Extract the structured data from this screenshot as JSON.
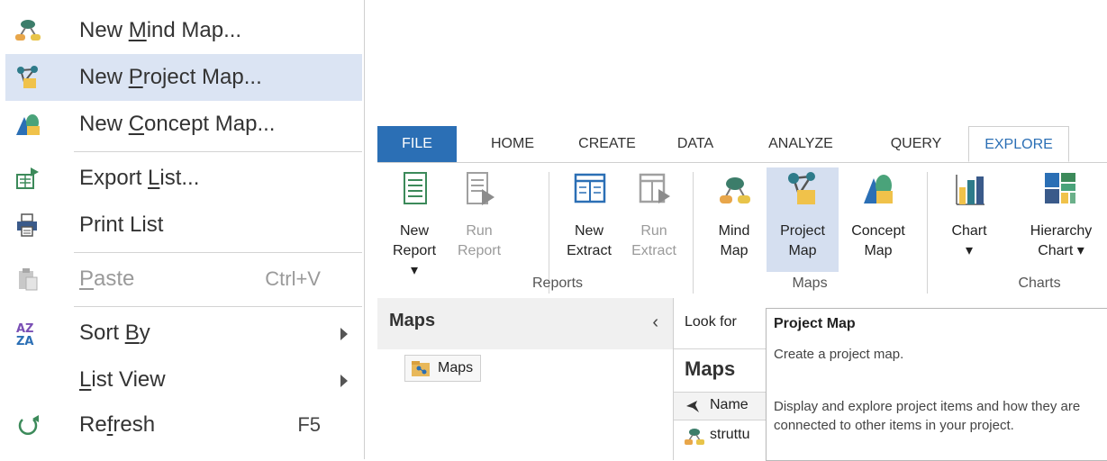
{
  "context_menu": {
    "items": [
      {
        "pre": "New ",
        "u": "M",
        "post": "ind Map...",
        "shortcut": "",
        "icon": "mind-map-icon"
      },
      {
        "pre": "New ",
        "u": "P",
        "post": "roject Map...",
        "shortcut": "",
        "icon": "project-map-icon",
        "highlighted": true
      },
      {
        "pre": "New ",
        "u": "C",
        "post": "oncept Map...",
        "shortcut": "",
        "icon": "concept-map-icon"
      },
      {
        "pre": "Export ",
        "u": "L",
        "post": "ist...",
        "shortcut": "",
        "icon": "export-list-icon"
      },
      {
        "pre": "Print List",
        "u": "",
        "post": "",
        "shortcut": "",
        "icon": "print-list-icon"
      },
      {
        "pre": "",
        "u": "P",
        "post": "aste",
        "shortcut": "Ctrl+V",
        "icon": "paste-icon",
        "disabled": true
      },
      {
        "pre": "Sort ",
        "u": "B",
        "post": "y",
        "shortcut": "",
        "icon": "sort-az-icon",
        "submenu": true
      },
      {
        "pre": "",
        "u": "L",
        "post": "ist View",
        "shortcut": "",
        "icon": "",
        "submenu": true
      },
      {
        "pre": "Re",
        "u": "f",
        "post": "resh",
        "shortcut": "F5",
        "icon": "refresh-icon"
      }
    ]
  },
  "ribbon": {
    "tabs": [
      "FILE",
      "HOME",
      "CREATE",
      "DATA",
      "ANALYZE",
      "QUERY",
      "EXPLORE"
    ],
    "active_tab": "EXPLORE",
    "buttons": {
      "new_report": {
        "line1": "New",
        "line2": "Report ▾"
      },
      "run_report": {
        "line1": "Run",
        "line2": "Report"
      },
      "new_extract": {
        "line1": "New",
        "line2": "Extract"
      },
      "run_extract": {
        "line1": "Run",
        "line2": "Extract"
      },
      "mind_map": {
        "line1": "Mind",
        "line2": "Map"
      },
      "project_map": {
        "line1": "Project",
        "line2": "Map"
      },
      "concept_map": {
        "line1": "Concept",
        "line2": "Map"
      },
      "chart": {
        "line1": "Chart",
        "line2": "▾"
      },
      "hierarchy_chart": {
        "line1": "Hierarchy",
        "line2": "Chart ▾"
      }
    },
    "groups": {
      "reports": "Reports",
      "maps": "Maps",
      "charts": "Charts"
    }
  },
  "nav_pane": {
    "title": "Maps",
    "collapse": "‹",
    "item": "Maps"
  },
  "list_pane": {
    "look_for": "Look for",
    "title": "Maps",
    "column_name": "Name",
    "rows": [
      "struttu"
    ]
  },
  "tooltip": {
    "title": "Project Map",
    "line1": "Create a project map.",
    "line2": "Display and explore project items and how they are connected to other items in your project."
  },
  "colors": {
    "accent": "#2b6fb5",
    "highlight": "#dbe4f3",
    "ribbon_selected": "#d5dff0"
  }
}
